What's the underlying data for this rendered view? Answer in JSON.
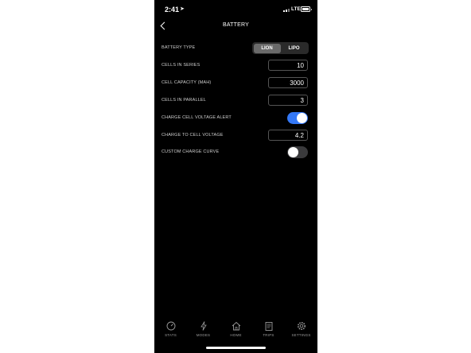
{
  "status_bar": {
    "time": "2:41",
    "network": "LTE"
  },
  "header": {
    "title": "BATTERY"
  },
  "settings": {
    "battery_type": {
      "label": "BATTERY TYPE",
      "options": [
        "LION",
        "LIPO"
      ],
      "selected": "LION"
    },
    "cells_in_series": {
      "label": "CELLS IN SERIES",
      "value": "10"
    },
    "cell_capacity": {
      "label": "CELL CAPACITY (MAH)",
      "value": "3000"
    },
    "cells_in_parallel": {
      "label": "CELLS IN PARALLEL",
      "value": "3"
    },
    "charge_cell_voltage_alert": {
      "label": "CHARGE CELL VOLTAGE ALERT",
      "enabled": true
    },
    "charge_to_cell_voltage": {
      "label": "CHARGE TO CELL VOLTAGE",
      "value": "4.2"
    },
    "custom_charge_curve": {
      "label": "CUSTOM CHARGE CURVE",
      "enabled": false
    }
  },
  "tab_bar": {
    "tabs": [
      {
        "label": "STATS",
        "icon": "gauge-icon"
      },
      {
        "label": "MODES",
        "icon": "lightning-icon"
      },
      {
        "label": "HOME",
        "icon": "home-icon"
      },
      {
        "label": "TRIPS",
        "icon": "clipboard-icon"
      },
      {
        "label": "SETTINGS",
        "icon": "gear-icon"
      }
    ]
  },
  "colors": {
    "accent": "#3478f6",
    "background": "#000000",
    "toggle_off": "#3a3a3c"
  }
}
